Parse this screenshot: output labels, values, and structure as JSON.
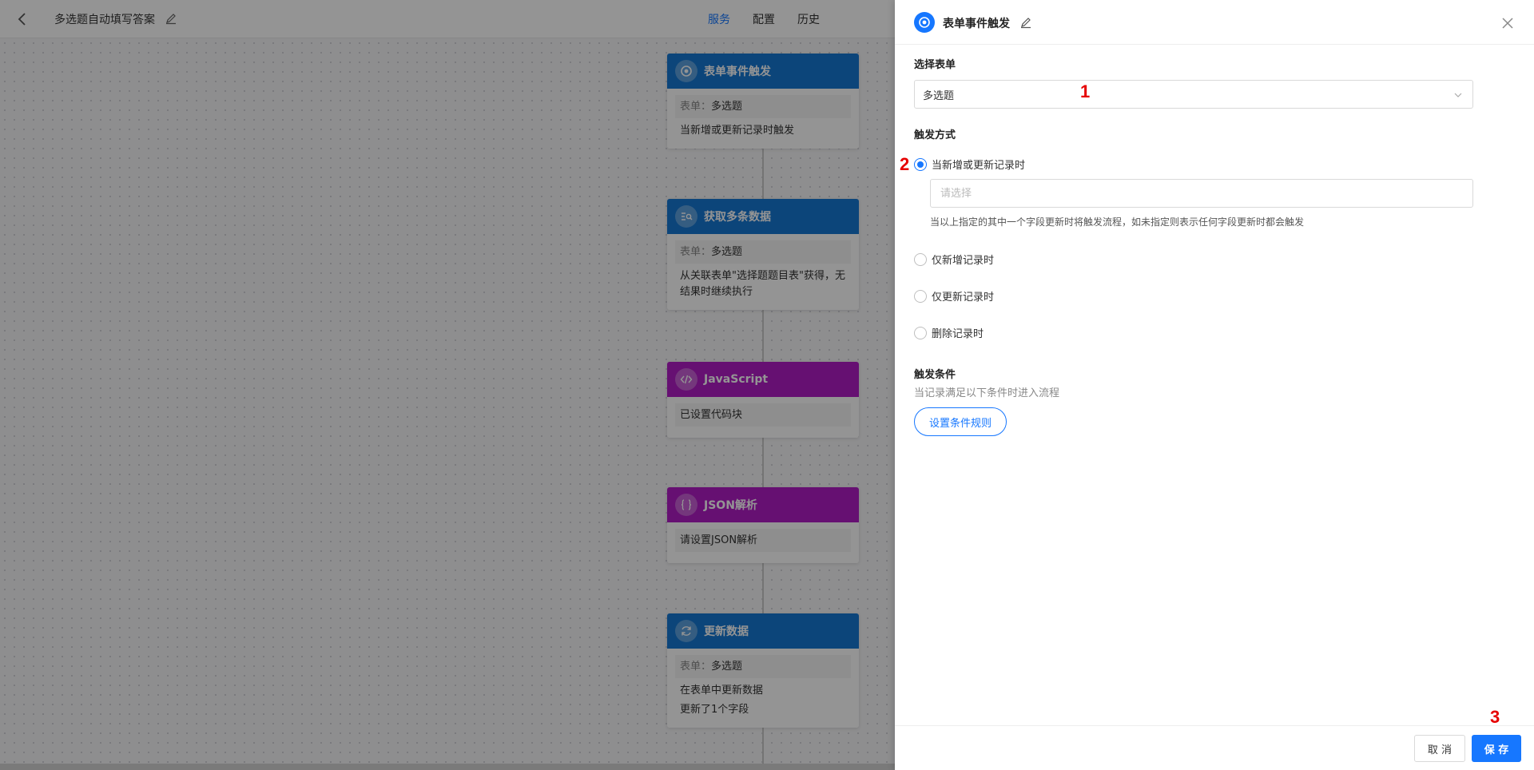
{
  "topbar": {
    "title": "多选题自动填写答案",
    "nav": [
      "服务",
      "配置",
      "历史"
    ]
  },
  "flow": {
    "nodes": [
      {
        "title": "表单事件触发",
        "icon": "target-icon",
        "form_key": "表单：",
        "form_value": "多选题",
        "text1": "当新增或更新记录时触发"
      },
      {
        "title": "获取多条数据",
        "icon": "search-list-icon",
        "form_key": "表单：",
        "form_value": "多选题",
        "text1": "从关联表单\"选择题题目表\"获得，无结果时继续执行"
      },
      {
        "title": "JavaScript",
        "icon": "code-icon",
        "text1": "已设置代码块"
      },
      {
        "title": "JSON解析",
        "icon": "braces-icon",
        "text1": "请设置JSON解析"
      },
      {
        "title": "更新数据",
        "icon": "refresh-icon",
        "form_key": "表单：",
        "form_value": "多选题",
        "text1": "在表单中更新数据",
        "text2": "更新了1个字段"
      }
    ]
  },
  "drawer": {
    "title": "表单事件触发",
    "select_form_label": "选择表单",
    "selected_form": "多选题",
    "trigger_label": "触发方式",
    "radio_options": [
      "当新增或更新记录时",
      "仅新增记录时",
      "仅更新记录时",
      "删除记录时"
    ],
    "field_placeholder": "请选择",
    "field_hint": "当以上指定的其中一个字段更新时将触发流程，如未指定则表示任何字段更新时都会触发",
    "condition_label": "触发条件",
    "condition_hint": "当记录满足以下条件时进入流程",
    "rule_button": "设置条件规则",
    "cancel": "取 消",
    "save": "保 存"
  },
  "markers": [
    "1",
    "2",
    "3"
  ],
  "colors": {
    "primary": "#1677ff",
    "node_blue": "#1677d2",
    "node_purple": "#b01cc4",
    "marker_red": "#e60000"
  }
}
